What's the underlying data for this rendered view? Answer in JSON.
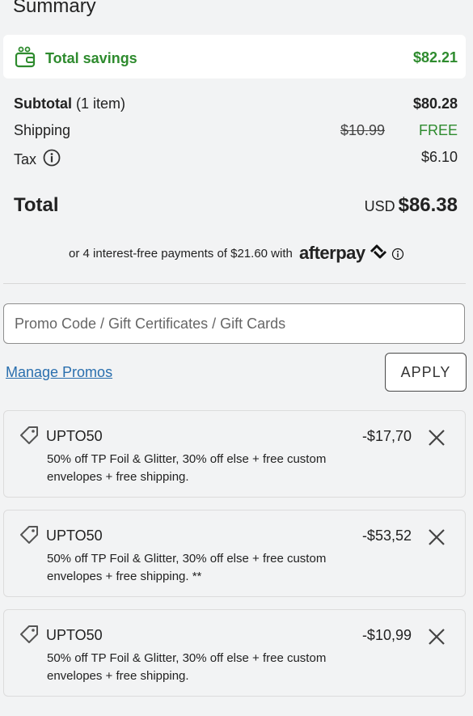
{
  "summary": {
    "title": "Summary",
    "savings": {
      "label": "Total savings",
      "amount": "$82.21"
    },
    "subtotal": {
      "label": "Subtotal",
      "count": "(1 item)",
      "value": "$80.28"
    },
    "shipping": {
      "label": "Shipping",
      "original": "$10.99",
      "value": "FREE"
    },
    "tax": {
      "label": "Tax",
      "value": "$6.10"
    },
    "total": {
      "label": "Total",
      "currency": "USD",
      "value": "$86.38"
    },
    "afterpay": {
      "text": "or 4 interest-free payments of $21.60 with",
      "logo": "afterpay"
    }
  },
  "promo": {
    "placeholder": "Promo Code / Gift Certificates / Gift Cards",
    "manage_label": "Manage Promos",
    "apply_label": "APPLY"
  },
  "applied_promos": [
    {
      "code": "UPTO50",
      "amount": "-$17,70",
      "description": "50% off TP Foil & Glitter, 30% off else + free custom envelopes + free shipping."
    },
    {
      "code": "UPTO50",
      "amount": "-$53,52",
      "description": "50% off TP Foil & Glitter, 30% off else + free custom envelopes + free shipping. **"
    },
    {
      "code": "UPTO50",
      "amount": "-$10,99",
      "description": "50% off TP Foil & Glitter, 30% off else + free custom envelopes + free shipping."
    }
  ],
  "colors": {
    "savings_green": "#2e8b2e",
    "link_blue": "#2a6fae",
    "background": "#f2f3f4"
  },
  "icons": {
    "savings": "wallet-icon",
    "tax_info": "info-icon",
    "promo": "tag-icon",
    "remove": "close-icon"
  }
}
